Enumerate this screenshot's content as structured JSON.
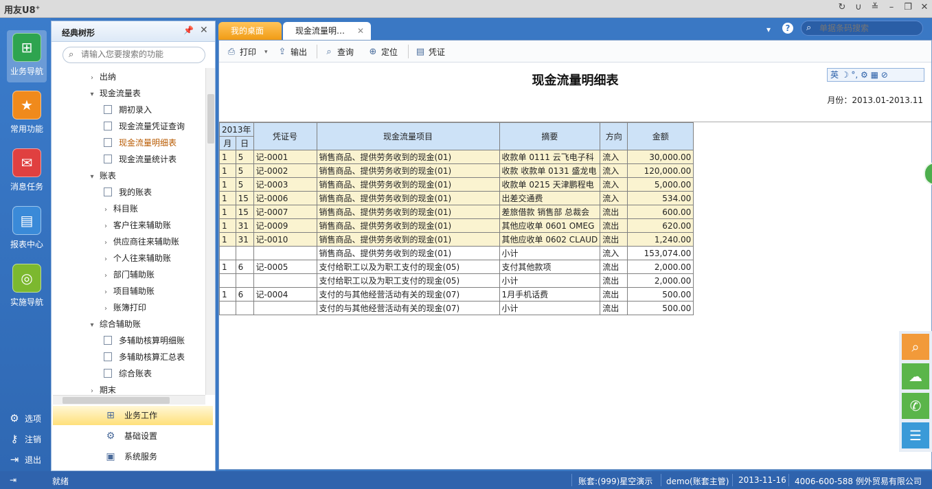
{
  "app": {
    "logo": "用友",
    "logo_suffix": "U8",
    "logo_sup": "+"
  },
  "nav": {
    "items": [
      {
        "label": "业务导航",
        "icon": "business-nav-icon",
        "color": "#2ea44f"
      },
      {
        "label": "常用功能",
        "icon": "star-icon",
        "color": "#f08a1c"
      },
      {
        "label": "消息任务",
        "icon": "mail-icon",
        "color": "#e04040"
      },
      {
        "label": "报表中心",
        "icon": "report-icon",
        "color": "#3a8ad8"
      },
      {
        "label": "实施导航",
        "icon": "compass-icon",
        "color": "#7cb82f"
      }
    ],
    "options": [
      "选项",
      "注销",
      "退出"
    ]
  },
  "tree": {
    "title": "经典树形",
    "search_placeholder": "请输入您要搜索的功能",
    "nodes": [
      {
        "label": "出纳",
        "type": "collapsed",
        "level": 1
      },
      {
        "label": "现金流量表",
        "type": "expanded",
        "level": 1
      },
      {
        "label": "期初录入",
        "type": "doc",
        "level": 2
      },
      {
        "label": "现金流量凭证查询",
        "type": "doc",
        "level": 2
      },
      {
        "label": "现金流量明细表",
        "type": "doc",
        "level": 2,
        "selected": true
      },
      {
        "label": "现金流量统计表",
        "type": "doc",
        "level": 2
      },
      {
        "label": "账表",
        "type": "expanded",
        "level": 1
      },
      {
        "label": "我的账表",
        "type": "doc",
        "level": 2
      },
      {
        "label": "科目账",
        "type": "collapsed",
        "level": 2
      },
      {
        "label": "客户往来辅助账",
        "type": "collapsed",
        "level": 2
      },
      {
        "label": "供应商往来辅助账",
        "type": "collapsed",
        "level": 2
      },
      {
        "label": "个人往来辅助账",
        "type": "collapsed",
        "level": 2
      },
      {
        "label": "部门辅助账",
        "type": "collapsed",
        "level": 2
      },
      {
        "label": "项目辅助账",
        "type": "collapsed",
        "level": 2
      },
      {
        "label": "账簿打印",
        "type": "collapsed",
        "level": 2
      },
      {
        "label": "综合辅助账",
        "type": "expanded",
        "level": 1
      },
      {
        "label": "多辅助核算明细账",
        "type": "doc",
        "level": 2
      },
      {
        "label": "多辅助核算汇总表",
        "type": "doc",
        "level": 2
      },
      {
        "label": "综合账表",
        "type": "doc",
        "level": 2
      },
      {
        "label": "期末",
        "type": "collapsed",
        "level": 1
      }
    ],
    "groups": [
      "业务工作",
      "基础设置",
      "系统服务"
    ]
  },
  "tabs": {
    "home": "我的桌面",
    "active": "现金流量明…"
  },
  "header": {
    "barcode_placeholder": "单据条码搜索"
  },
  "toolbar": {
    "print": "打印",
    "export": "输出",
    "query": "查询",
    "locate": "定位",
    "voucher": "凭证"
  },
  "report": {
    "title": "现金流量明细表",
    "month_label": "月份：2013.01-2013.11",
    "ime_text": "英 ☽ °, ⚙ ▦ ⊘",
    "headers": {
      "year": "2013年",
      "month": "月",
      "day": "日",
      "voucher": "凭证号",
      "item": "现金流量项目",
      "summary": "摘要",
      "direction": "方向",
      "amount": "金额"
    },
    "rows": [
      {
        "m": "1",
        "d": "5",
        "v": "记-0001",
        "item": "销售商品、提供劳务收到的现金(01)",
        "sum": "收款单 0111 云飞电子科",
        "dir": "流入",
        "amt": "30,000.00",
        "shade": true
      },
      {
        "m": "1",
        "d": "5",
        "v": "记-0002",
        "item": "销售商品、提供劳务收到的现金(01)",
        "sum": "收款 收款单 0131 盛龙电",
        "dir": "流入",
        "amt": "120,000.00",
        "shade": true
      },
      {
        "m": "1",
        "d": "5",
        "v": "记-0003",
        "item": "销售商品、提供劳务收到的现金(01)",
        "sum": "收款单 0215 天津鹏程电",
        "dir": "流入",
        "amt": "5,000.00",
        "shade": true
      },
      {
        "m": "1",
        "d": "15",
        "v": "记-0006",
        "item": "销售商品、提供劳务收到的现金(01)",
        "sum": "出差交通费",
        "dir": "流入",
        "amt": "534.00",
        "shade": true
      },
      {
        "m": "1",
        "d": "15",
        "v": "记-0007",
        "item": "销售商品、提供劳务收到的现金(01)",
        "sum": "差旅借款 销售部 总裁会",
        "dir": "流出",
        "amt": "600.00",
        "shade": true
      },
      {
        "m": "1",
        "d": "31",
        "v": "记-0009",
        "item": "销售商品、提供劳务收到的现金(01)",
        "sum": "其他应收单 0601 OMEG",
        "dir": "流出",
        "amt": "620.00",
        "shade": true
      },
      {
        "m": "1",
        "d": "31",
        "v": "记-0010",
        "item": "销售商品、提供劳务收到的现金(01)",
        "sum": "其他应收单 0602 CLAUD",
        "dir": "流出",
        "amt": "1,240.00",
        "shade": true
      },
      {
        "m": "",
        "d": "",
        "v": "",
        "item": "销售商品、提供劳务收到的现金(01)",
        "sum": "小计",
        "dir": "流入",
        "amt": "153,074.00",
        "shade": false
      },
      {
        "m": "1",
        "d": "6",
        "v": "记-0005",
        "item": "支付给职工以及为职工支付的现金(05)",
        "sum": "支付其他款项",
        "dir": "流出",
        "amt": "2,000.00",
        "shade": false
      },
      {
        "m": "",
        "d": "",
        "v": "",
        "item": "支付给职工以及为职工支付的现金(05)",
        "sum": "小计",
        "dir": "流出",
        "amt": "2,000.00",
        "shade": false
      },
      {
        "m": "1",
        "d": "6",
        "v": "记-0004",
        "item": "支付的与其他经营活动有关的现金(07)",
        "sum": "1月手机话费",
        "dir": "流出",
        "amt": "500.00",
        "shade": false
      },
      {
        "m": "",
        "d": "",
        "v": "",
        "item": "支付的与其他经营活动有关的现金(07)",
        "sum": "小计",
        "dir": "流出",
        "amt": "500.00",
        "shade": false
      }
    ]
  },
  "status": {
    "ready": "就绪",
    "account": "账套:(999)星空演示",
    "user": "demo(账套主管)",
    "date": "2013-11-16",
    "company": "4006-600-588 例外贸易有限公司"
  },
  "colors": {
    "accent": "#3a78c4",
    "tab_orange": "#f09a12",
    "header_blue": "#cde2f7",
    "row_shade": "#faf3d0"
  }
}
